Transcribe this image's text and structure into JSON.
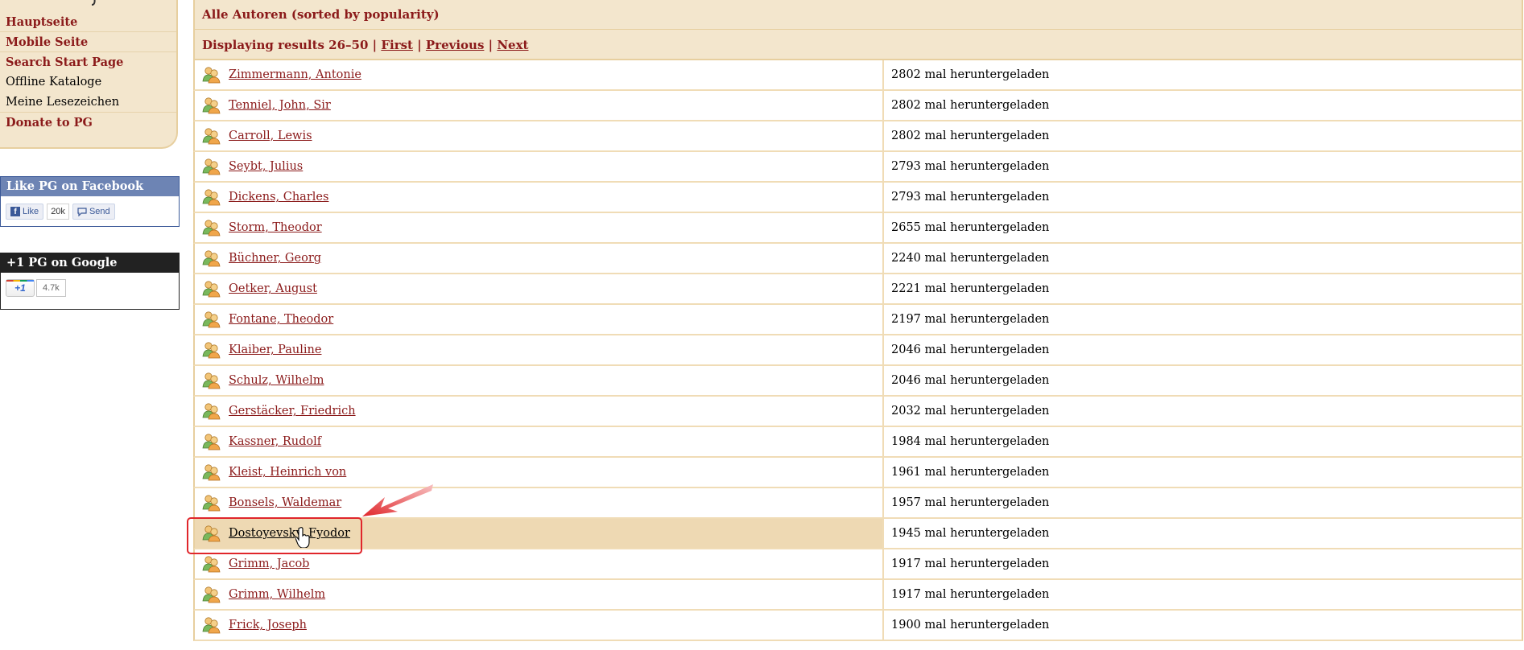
{
  "sidebar": {
    "items": [
      {
        "label": "Hauptseite"
      },
      {
        "label": "Mobile Seite"
      },
      {
        "label": "Search Start Page"
      },
      {
        "label": "Offline Kataloge"
      },
      {
        "label": "Meine Lesezeichen"
      },
      {
        "label": "Donate to PG"
      }
    ]
  },
  "facebook": {
    "title": "Like PG on Facebook",
    "like_label": "Like",
    "like_count": "20k",
    "send_label": "Send"
  },
  "google": {
    "title": "+1 PG on Google",
    "plus_label": "+1",
    "count": "4.7k"
  },
  "header": {
    "title": "Alle Autoren (sorted by popularity)"
  },
  "pager": {
    "text": "Displaying results 26–50 |",
    "first": "First",
    "sep1": "|",
    "previous": "Previous",
    "sep2": "|",
    "next": "Next"
  },
  "authors": [
    {
      "name": "Zimmermann, Antonie",
      "downloads": "2802 mal heruntergeladen"
    },
    {
      "name": "Tenniel, John, Sir",
      "downloads": "2802 mal heruntergeladen"
    },
    {
      "name": "Carroll, Lewis",
      "downloads": "2802 mal heruntergeladen"
    },
    {
      "name": "Seybt, Julius",
      "downloads": "2793 mal heruntergeladen"
    },
    {
      "name": "Dickens, Charles",
      "downloads": "2793 mal heruntergeladen"
    },
    {
      "name": "Storm, Theodor",
      "downloads": "2655 mal heruntergeladen"
    },
    {
      "name": "Büchner, Georg",
      "downloads": "2240 mal heruntergeladen"
    },
    {
      "name": "Oetker, August",
      "downloads": "2221 mal heruntergeladen"
    },
    {
      "name": "Fontane, Theodor",
      "downloads": "2197 mal heruntergeladen"
    },
    {
      "name": "Klaiber, Pauline",
      "downloads": "2046 mal heruntergeladen"
    },
    {
      "name": "Schulz, Wilhelm",
      "downloads": "2046 mal heruntergeladen"
    },
    {
      "name": "Gerstäcker, Friedrich",
      "downloads": "2032 mal heruntergeladen"
    },
    {
      "name": "Kassner, Rudolf",
      "downloads": "1984 mal heruntergeladen"
    },
    {
      "name": "Kleist, Heinrich von",
      "downloads": "1961 mal heruntergeladen"
    },
    {
      "name": "Bonsels, Waldemar",
      "downloads": "1957 mal heruntergeladen"
    },
    {
      "name": "Dostoyevsky, Fyodor",
      "downloads": "1945 mal heruntergeladen"
    },
    {
      "name": "Grimm, Jacob",
      "downloads": "1917 mal heruntergeladen"
    },
    {
      "name": "Grimm, Wilhelm",
      "downloads": "1917 mal heruntergeladen"
    },
    {
      "name": "Frick, Joseph",
      "downloads": "1900 mal heruntergeladen"
    }
  ],
  "colors": {
    "link": "#8b1a1a",
    "header_bg": "#f3e6cd",
    "highlight_row": "#eed9b3",
    "annotation_red": "#e0262b",
    "facebook_blue": "#6d84b4"
  }
}
